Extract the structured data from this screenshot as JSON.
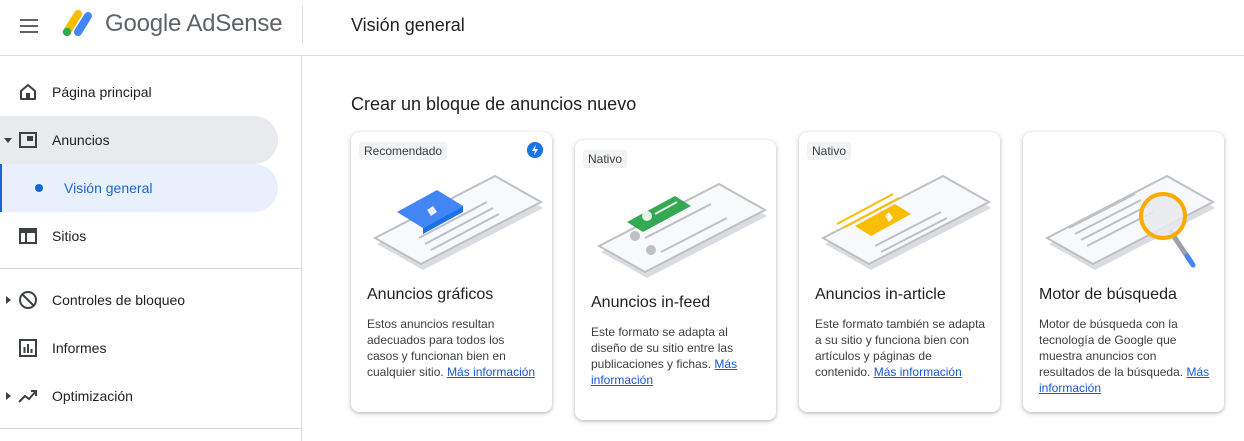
{
  "header": {
    "brand": "Google AdSense",
    "page_title": "Visión general"
  },
  "sidebar": {
    "items": [
      {
        "label": "Página principal",
        "icon": "home-icon"
      },
      {
        "label": "Anuncios",
        "icon": "ads-icon"
      },
      {
        "label": "Visión general",
        "icon": "dot"
      },
      {
        "label": "Sitios",
        "icon": "sites-icon"
      },
      {
        "label": "Controles de bloqueo",
        "icon": "block-icon"
      },
      {
        "label": "Informes",
        "icon": "reports-icon"
      },
      {
        "label": "Optimización",
        "icon": "trending-icon"
      }
    ]
  },
  "main": {
    "section_title": "Crear un bloque de anuncios nuevo",
    "cards": [
      {
        "badge": "Recomendado",
        "title": "Anuncios gráficos",
        "description": "Estos anuncios resultan adecuados para todos los casos y funcionan bien en cualquier sitio.",
        "link": "Más información",
        "accent": "#4285f4"
      },
      {
        "badge": "Nativo",
        "title": "Anuncios in-feed",
        "description": "Este formato se adapta al diseño de su sitio entre las publicaciones y fichas.",
        "link": "Más información",
        "accent": "#34a853"
      },
      {
        "badge": "Nativo",
        "title": "Anuncios in-article",
        "description": "Este formato también se adapta a su sitio y funciona bien con artículos y páginas de contenido.",
        "link": "Más información",
        "accent": "#fbbc04"
      },
      {
        "badge": "",
        "title": "Motor de búsqueda",
        "description": "Motor de búsqueda con la tecnología de Google que muestra anuncios con resultados de la búsqueda.",
        "link": "Más información",
        "accent": "#f9ab00"
      }
    ]
  }
}
